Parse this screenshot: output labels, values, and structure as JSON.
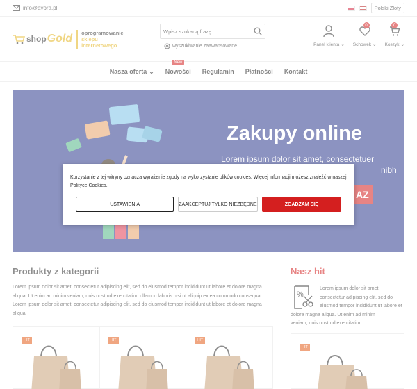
{
  "topbar": {
    "email": "info@avora.pl",
    "currency": "Polski Złoty"
  },
  "logo": {
    "shop": "shop",
    "gold": "Gold",
    "tagline_1": "oprogramowanie",
    "tagline_2": "sklepu",
    "tagline_3": "internetowego"
  },
  "search": {
    "placeholder": "Wpisz szukaną frazę ...",
    "advanced": "wyszukiwanie zaawansowane"
  },
  "header_icons": {
    "account": "Panel klienta",
    "wishlist": "Schowek",
    "wishlist_count": "0",
    "cart": "Koszyk",
    "cart_count": "0"
  },
  "nav": {
    "items": [
      "Nasza oferta",
      "Nowości",
      "Regulamin",
      "Płatności",
      "Kontakt"
    ],
    "new_badge": "New"
  },
  "banner": {
    "headline": "Zakupy online",
    "sub_1": "Lorem ipsum dolor sit amet, consectetuer",
    "sub_2": "nibh",
    "cta": "AZ"
  },
  "sections": {
    "products_title": "Produkty z kategorii",
    "products_text_1": "Lorem ipsum dolor sit amet, consectetur adipiscing elit, sed do eiusmod tempor incididunt ut labore et dolore magna",
    "products_text_2": "aliqua. Ut enim ad minim veniam, quis nostrud exercitation ullamco laboris nisi ut aliquip ex ea commodo consequat.",
    "products_text_3": "Lorem ipsum dolor sit amet, consectetur adipiscing elit, sed do eiusmod tempor incididunt ut labore et dolore magna",
    "products_text_4": "aliqua.",
    "hit_title": "Nasz hit",
    "hit_text_1": "Lorem ipsum dolor sit amet,",
    "hit_text_2": "consectetur adipiscing elit, sed do",
    "hit_text_3": "eiusmod tempor incididunt ut labore et",
    "hit_text_4": "dolore magna aliqua. Ut enim ad minim",
    "hit_text_5": "veniam, quis nostrud exercitation.",
    "hit_label": "HIT"
  },
  "cookie": {
    "message": "Korzystanie z tej witryny oznacza wyrażenie zgody na wykorzystanie plików cookies. Więcej informacji możesz znaleźć w naszej Polityce Cookies.",
    "settings": "USTAWIENIA",
    "necessary": "ZAAKCEPTUJ TYLKO NIEZBĘDNE",
    "agree": "ZGADZAM SIĘ"
  },
  "colors": {
    "accent": "#d41f1f",
    "gold": "#e3b520",
    "banner": "#2f3b8e"
  }
}
